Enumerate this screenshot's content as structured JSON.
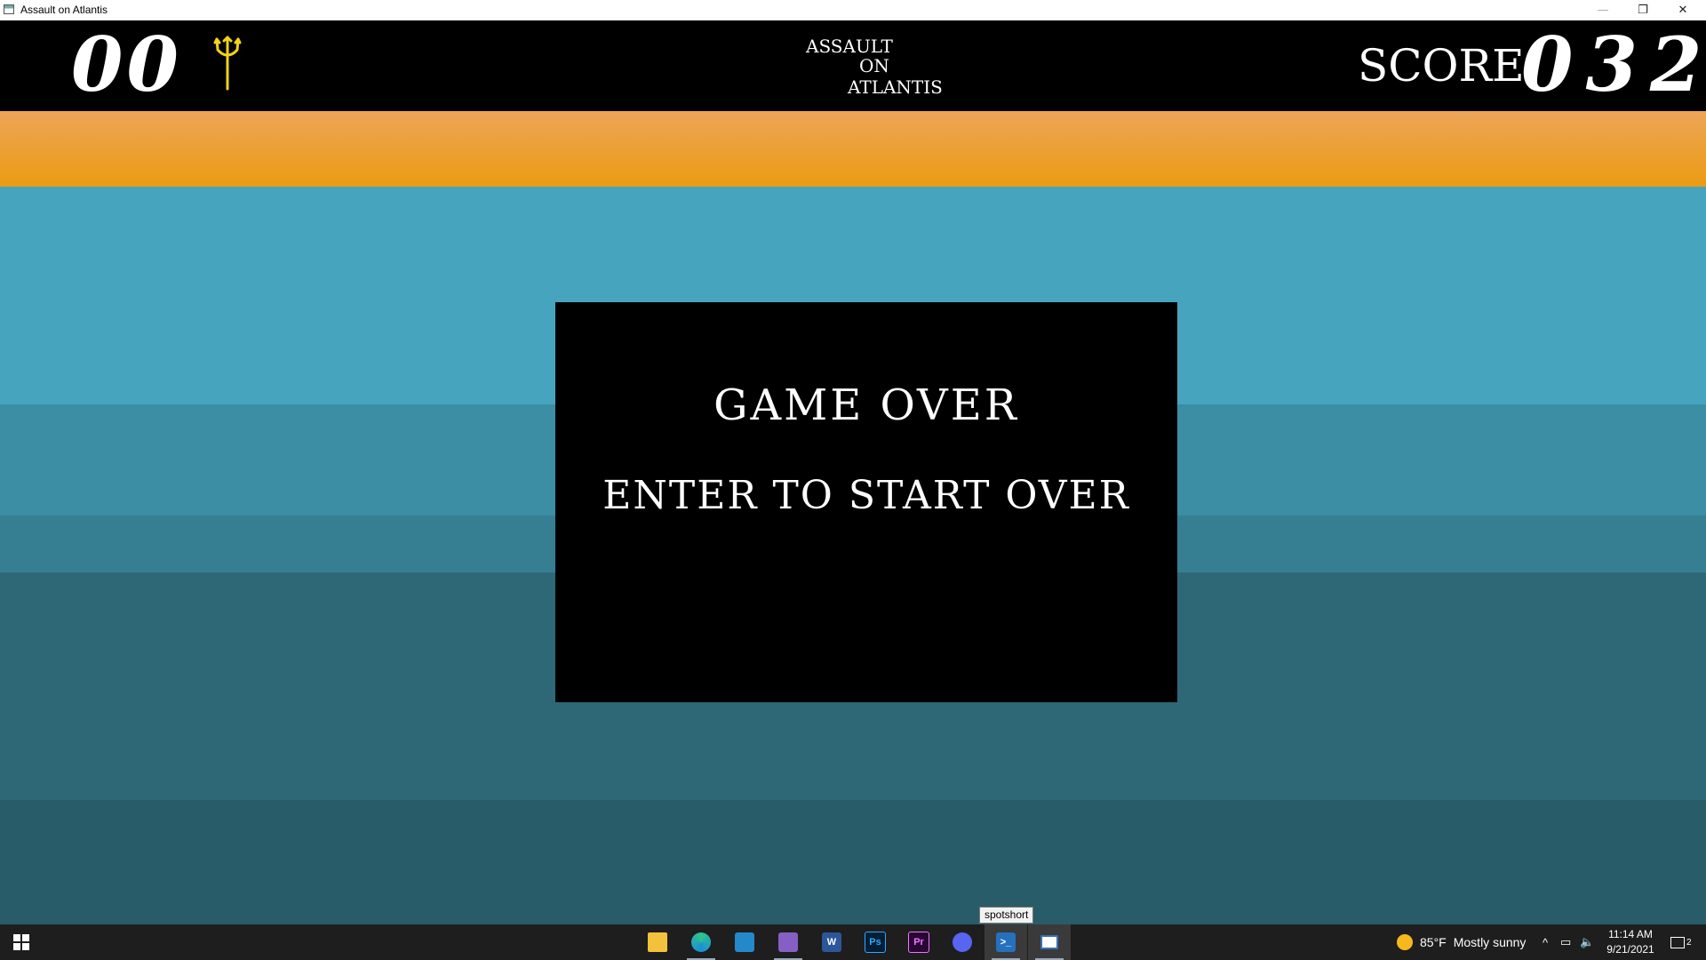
{
  "window": {
    "title": "Assault on Atlantis",
    "minimize_glyph": "—",
    "maximize_glyph": "❐",
    "close_glyph": "✕"
  },
  "hud": {
    "lives": "00",
    "lives_icon": "trident-icon",
    "title_line1": "ASSAULT",
    "title_line2": "ON",
    "title_line3": "ATLANTIS",
    "score_label": "SCORE",
    "score_value": "032"
  },
  "dialog": {
    "title": "GAME OVER",
    "subtitle": "ENTER TO START OVER"
  },
  "tooltip": {
    "text": "spotshort"
  },
  "taskbar": {
    "apps": [
      {
        "name": "file-explorer-icon",
        "label": ""
      },
      {
        "name": "edge-icon",
        "label": ""
      },
      {
        "name": "vscode-icon",
        "label": ""
      },
      {
        "name": "visual-studio-icon",
        "label": ""
      },
      {
        "name": "word-icon",
        "label": "W"
      },
      {
        "name": "photoshop-icon",
        "label": "Ps"
      },
      {
        "name": "premiere-icon",
        "label": "Pr"
      },
      {
        "name": "discord-icon",
        "label": ""
      },
      {
        "name": "powershell-icon",
        "label": ""
      },
      {
        "name": "game-window-icon",
        "label": ""
      }
    ],
    "weather_temp": "85°F",
    "weather_text": "Mostly sunny",
    "time": "11:14 AM",
    "date": "9/21/2021",
    "notification_count": "2"
  },
  "colors": {
    "sky_top": "#eda459",
    "sky_bottom": "#eb9c12",
    "sea_light": "#47a4bf",
    "sea_dark": "#295c69",
    "trident": "#f2d21a"
  }
}
